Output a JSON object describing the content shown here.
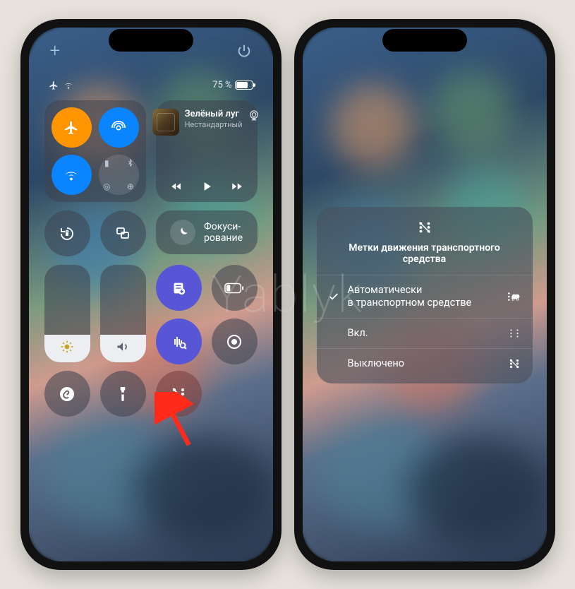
{
  "watermark": "Yablyk",
  "status": {
    "battery_text": "75 %",
    "battery_level": 75
  },
  "connectivity": {
    "airplane": "airplane",
    "airdrop": "airdrop",
    "wifi": "wifi",
    "cellular": "cellular",
    "bluetooth": "bluetooth",
    "hotspot": "hotspot",
    "vpn": "vpn"
  },
  "music": {
    "title": "Зелёный луг",
    "subtitle": "Нестандартный"
  },
  "focus": {
    "label": "Фокуси-\nрование"
  },
  "controls": {
    "orientation_lock": "orientation-lock",
    "screen_mirroring": "screen-mirroring",
    "notes": "notes",
    "low_power": "low-power",
    "sound_recognition": "sound-recognition",
    "screen_record": "screen-record",
    "shazam": "shazam",
    "flashlight": "flashlight",
    "motion_cues": "motion-cues"
  },
  "motion_panel": {
    "title": "Метки движения транспортного средства",
    "options": [
      {
        "label": "Автоматически\nв транспортном средстве",
        "checked": true,
        "icon": "auto"
      },
      {
        "label": "Вкл.",
        "checked": false,
        "icon": "on"
      },
      {
        "label": "Выключено",
        "checked": false,
        "icon": "off"
      }
    ]
  }
}
